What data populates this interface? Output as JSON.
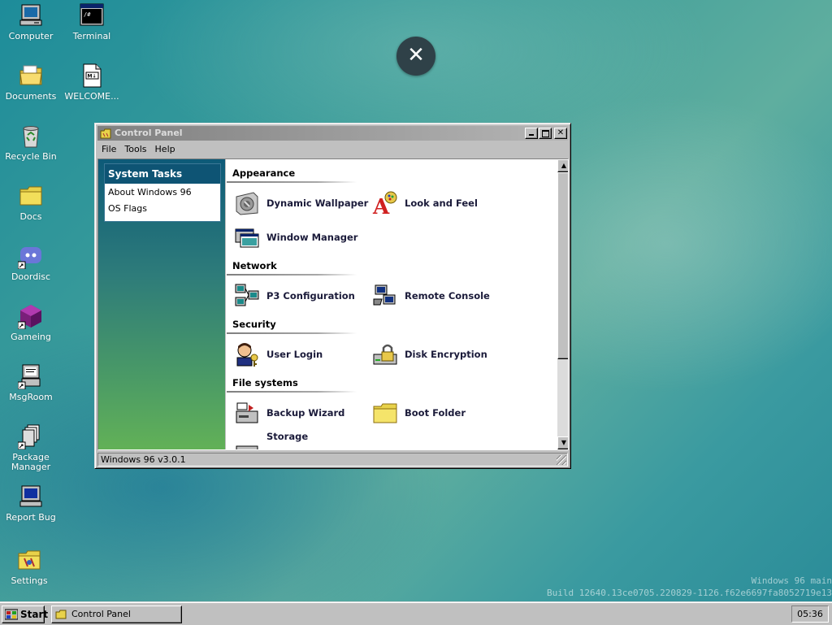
{
  "desktop": {
    "icons": [
      {
        "label": "Computer"
      },
      {
        "label": "Terminal"
      },
      {
        "label": "Documents"
      },
      {
        "label": "WELCOME..."
      },
      {
        "label": "Recycle Bin"
      },
      {
        "label": "Docs"
      },
      {
        "label": "Doordisc"
      },
      {
        "label": "Gameing"
      },
      {
        "label": "MsgRoom"
      },
      {
        "label": "Package Manager"
      },
      {
        "label": "Report Bug"
      },
      {
        "label": "Settings"
      }
    ]
  },
  "overlay": {
    "close_glyph": "✕"
  },
  "window": {
    "title": "Control Panel",
    "menu": [
      "File",
      "Tools",
      "Help"
    ],
    "sidebar": {
      "heading": "System Tasks",
      "links": [
        "About Windows 96",
        "OS Flags"
      ]
    },
    "sections": [
      {
        "title": "Appearance",
        "items": [
          "Dynamic Wallpaper",
          "Look and Feel",
          "Window Manager"
        ]
      },
      {
        "title": "Network",
        "items": [
          "P3 Configuration",
          "Remote Console"
        ]
      },
      {
        "title": "Security",
        "items": [
          "User Login",
          "Disk Encryption"
        ]
      },
      {
        "title": "File systems",
        "items": [
          "Backup Wizard",
          "Boot Folder",
          "Storage"
        ]
      }
    ],
    "status": "Windows 96 v3.0.1"
  },
  "watermark": {
    "line1": "Windows 96 main",
    "line2": "Build 12640.13ce0705.220829-1126.f62e6697fa8052719e13"
  },
  "taskbar": {
    "start_label": "Start",
    "task_label": "Control Panel",
    "clock": "05:36"
  },
  "colors": {
    "accent": "#0e5474",
    "titlebar_inactive": "#808080"
  }
}
